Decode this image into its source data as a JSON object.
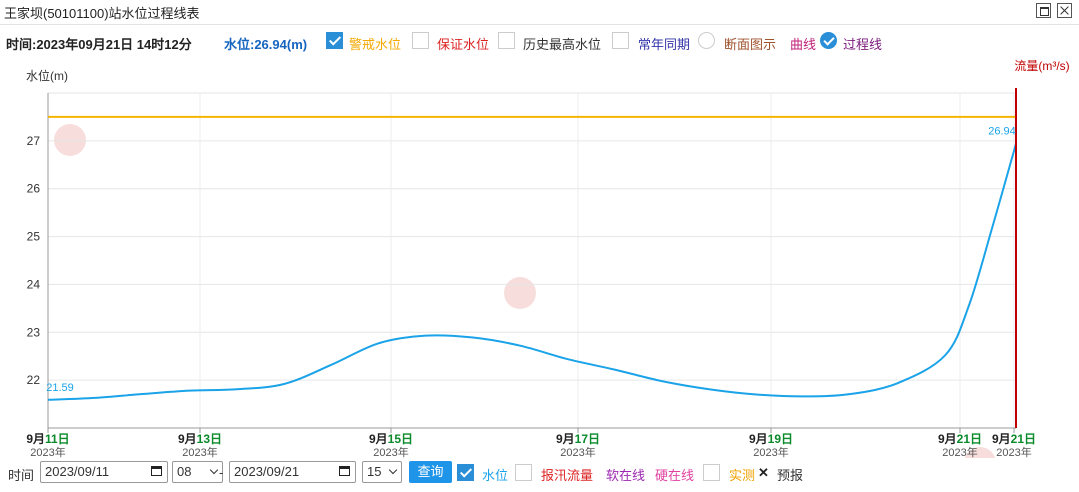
{
  "window": {
    "title": "王家坝(50101100)站水位过程线表",
    "maximize_icon": "maximize-icon",
    "close_icon": "close-icon"
  },
  "toolbar": {
    "time_label": "时间:2023年09月21日 14时12分",
    "water_level_label": "水位:26.94(m)",
    "items": [
      {
        "label": "警戒水位",
        "checked": true,
        "color": "#f5a800"
      },
      {
        "label": "保证水位",
        "checked": false,
        "color": "#d22"
      },
      {
        "label": "历史最高水位",
        "checked": false,
        "color": "#333"
      },
      {
        "label": "常年同期",
        "checked": false,
        "color": "#3333aa"
      }
    ],
    "radio_section": {
      "label": "断面图示",
      "selected": false,
      "color": "#a0522d"
    },
    "radio_curve": {
      "label": "曲线",
      "selected": false,
      "color": "#c02077"
    },
    "radio_process": {
      "label": "过程线",
      "selected": true,
      "color": "#7a1a7a"
    }
  },
  "chart_data": {
    "type": "line",
    "ylabel": "水位(m)",
    "y2label": "流量(m³/s)",
    "ylim": [
      21,
      28
    ],
    "yticks": [
      22,
      23,
      24,
      25,
      26,
      27
    ],
    "grid": true,
    "x_ticks": [
      {
        "day": "9月",
        "day_hl": "11日",
        "year": "2023年"
      },
      {
        "day": "9月",
        "day_hl": "13日",
        "year": "2023年"
      },
      {
        "day": "9月",
        "day_hl": "15日",
        "year": "2023年"
      },
      {
        "day": "9月",
        "day_hl": "17日",
        "year": "2023年"
      },
      {
        "day": "9月",
        "day_hl": "19日",
        "year": "2023年"
      },
      {
        "day": "9月",
        "day_hl": "21日",
        "year": "2023年"
      },
      {
        "day": "9月",
        "day_hl": "21日",
        "year": "2023年"
      }
    ],
    "series": [
      {
        "color": "#1aa3e8",
        "x": [
          "2023-09-11 08:00",
          "2023-09-11 20:00",
          "2023-09-12 08:00",
          "2023-09-12 20:00",
          "2023-09-13 08:00",
          "2023-09-13 20:00",
          "2023-09-14 08:00",
          "2023-09-14 20:00",
          "2023-09-15 08:00",
          "2023-09-15 20:00",
          "2023-09-16 08:00",
          "2023-09-16 20:00",
          "2023-09-17 08:00",
          "2023-09-17 20:00",
          "2023-09-18 08:00",
          "2023-09-18 20:00",
          "2023-09-19 08:00",
          "2023-09-19 20:00",
          "2023-09-20 08:00",
          "2023-09-20 20:00",
          "2023-09-21 02:00",
          "2023-09-21 08:00",
          "2023-09-21 14:00"
        ],
        "values": [
          21.59,
          21.63,
          21.71,
          21.78,
          21.81,
          21.92,
          22.32,
          22.77,
          22.93,
          22.89,
          22.72,
          22.44,
          22.22,
          21.98,
          21.81,
          21.7,
          21.66,
          21.71,
          21.94,
          22.52,
          23.55,
          25.2,
          26.94
        ]
      }
    ],
    "warning_level": {
      "value": 27.5,
      "color": "#f5b400"
    },
    "point_labels": [
      {
        "text": "21.59",
        "x": "2023-09-11 08:00",
        "y": 21.59
      },
      {
        "text": "26.94",
        "x": "2023-09-21 14:00",
        "y": 26.94
      }
    ],
    "current_marker": {
      "x": "2023-09-21 14:00",
      "color": "#c00000"
    }
  },
  "watermark": {
    "text": "阜阳公众网",
    "icon": "logo-seal-icon"
  },
  "bottom": {
    "time_label": "时间",
    "start_date": "2023/09/11",
    "start_hour": "08",
    "dash": "-",
    "end_date": "2023/09/21",
    "interval": "15",
    "query_label": "查询",
    "calendar_icon": "calendar-icon",
    "dropdown_icon": "chevron-down-icon",
    "items": [
      {
        "label": "水位",
        "checked": true,
        "color": "#1aa3e8"
      },
      {
        "label": "报汛流量",
        "checked": false,
        "color": "#d22"
      },
      {
        "label": "软在线",
        "color": "#9c27b0"
      },
      {
        "label": "硬在线",
        "color": "#e040a0"
      },
      {
        "label": "实测",
        "checked": false,
        "color": "#f0a000"
      },
      {
        "label": "预报",
        "color": "#333"
      }
    ]
  }
}
